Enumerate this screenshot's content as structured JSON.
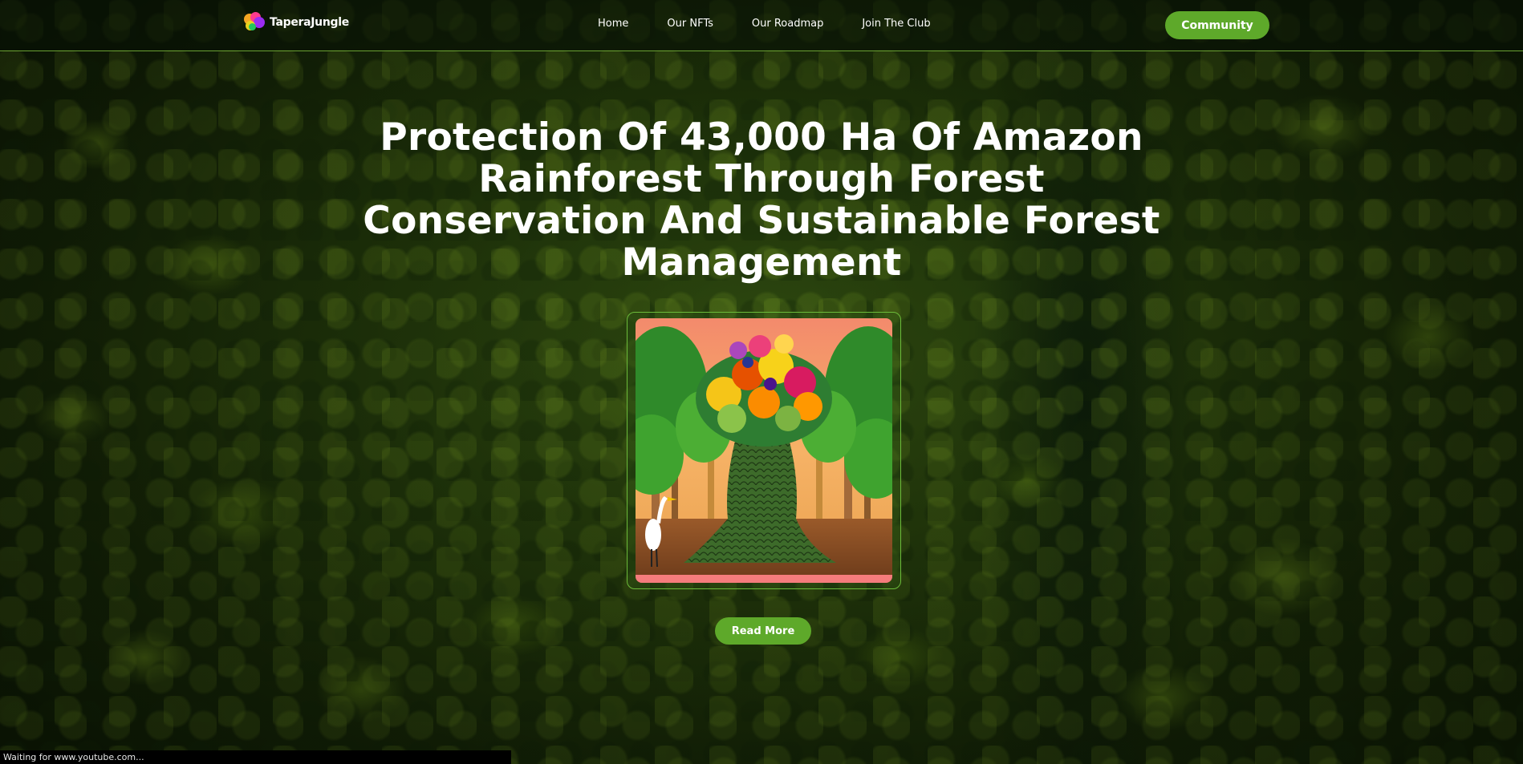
{
  "brand": {
    "name": "TaperaJungle",
    "logo_icon": "colorful-bubbles-logo",
    "accent_color": "#5ea92a"
  },
  "nav": {
    "items": [
      {
        "label": "Home"
      },
      {
        "label": "Our NFTs"
      },
      {
        "label": "Our Roadmap"
      },
      {
        "label": "Join The Club"
      }
    ],
    "cta_label": "Community"
  },
  "hero": {
    "title": "Protection Of 43,000 Ha Of Amazon Rainforest Through Forest Conservation And Sustainable Forest Management",
    "image_icon": "tree-nft-artwork",
    "button_label": "Read More"
  },
  "status_bar": {
    "text": "Waiting for www.youtube.com..."
  }
}
